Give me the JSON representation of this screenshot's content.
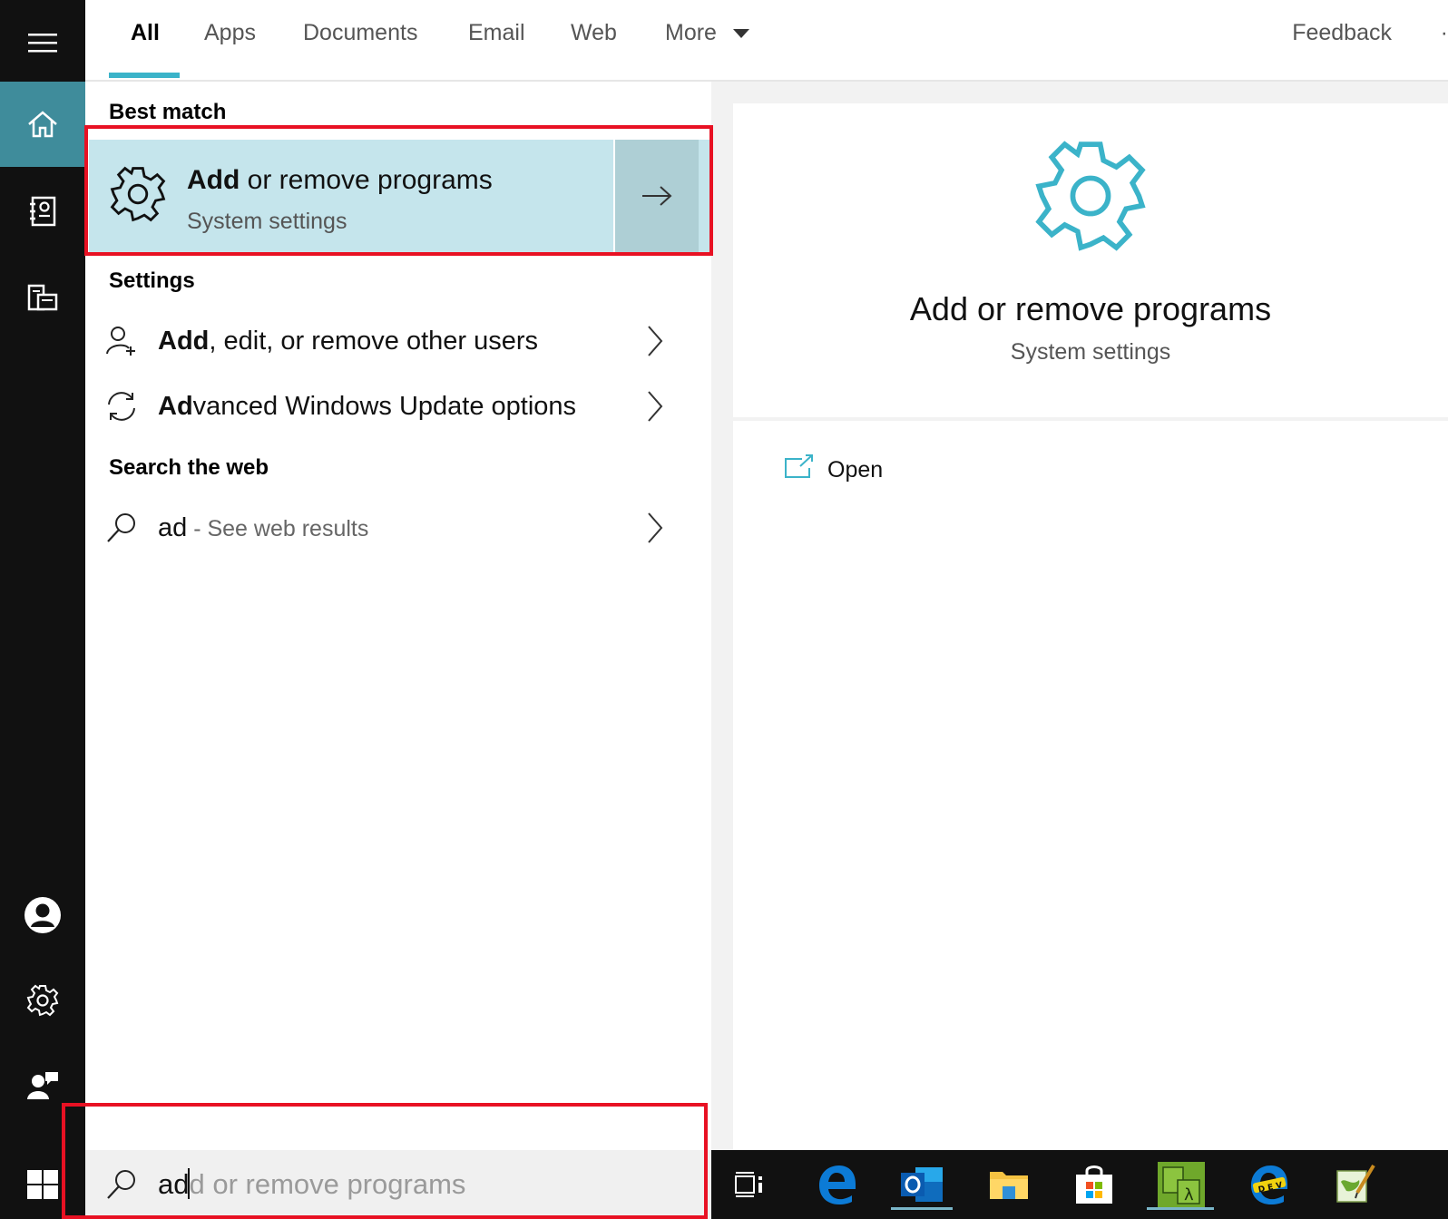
{
  "tabs": [
    {
      "label": "All",
      "active": true
    },
    {
      "label": "Apps"
    },
    {
      "label": "Documents"
    },
    {
      "label": "Email"
    },
    {
      "label": "Web"
    },
    {
      "label": "More"
    }
  ],
  "feedback_label": "Feedback",
  "overflow_label": "·",
  "best_match": {
    "section": "Best match",
    "title_bold": "Add",
    "title_rest": " or remove programs",
    "subtitle": "System settings"
  },
  "settings": {
    "section": "Settings",
    "items": [
      {
        "bold": "Add",
        "rest": ", edit, or remove other users",
        "icon": "add-user-icon"
      },
      {
        "bold": "Ad",
        "rest": "vanced Windows Update options",
        "icon": "sync-icon"
      }
    ]
  },
  "web": {
    "section": "Search the web",
    "query": "ad",
    "suffix": " - See web results"
  },
  "preview": {
    "title": "Add or remove programs",
    "subtitle": "System settings",
    "open_label": "Open"
  },
  "search": {
    "typed": "ad",
    "ghost": "d or remove programs"
  },
  "colors": {
    "accent": "#3bb3c9",
    "highlight": "#c5e5ec",
    "highlight_arrow": "#aecfd5",
    "rail": "#111111",
    "rail_active": "#3f8c9b",
    "annotation": "#e81123"
  },
  "taskbar_apps": [
    "task-view-icon",
    "edge-icon",
    "outlook-icon",
    "file-explorer-icon",
    "store-icon",
    "app-lambda-icon",
    "edge-dev-icon",
    "notepad-icon"
  ]
}
